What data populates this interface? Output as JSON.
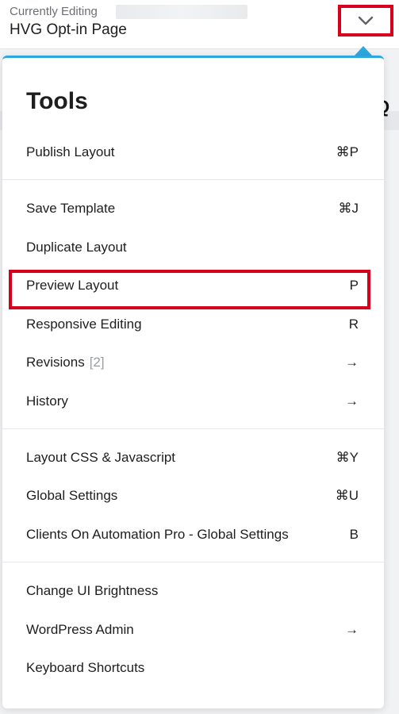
{
  "header": {
    "subtitle": "Currently Editing",
    "title": "HVG Opt-in Page",
    "toggle_icon": "chevron-down-icon"
  },
  "panel": {
    "title": "Tools",
    "groups": [
      {
        "items": [
          {
            "label": "Publish Layout",
            "shortcut": "⌘P"
          }
        ]
      },
      {
        "items": [
          {
            "label": "Save Template",
            "shortcut": "⌘J"
          },
          {
            "label": "Duplicate Layout",
            "shortcut": ""
          },
          {
            "label": "Preview Layout",
            "shortcut": "P"
          },
          {
            "label": "Responsive Editing",
            "shortcut": "R"
          },
          {
            "label": "Revisions",
            "count": "[2]",
            "shortcut": "→"
          },
          {
            "label": "History",
            "shortcut": "→"
          }
        ]
      },
      {
        "items": [
          {
            "label": "Layout CSS & Javascript",
            "shortcut": "⌘Y"
          },
          {
            "label": "Global Settings",
            "shortcut": "⌘U"
          },
          {
            "label": "Clients On Automation Pro - Global Settings",
            "shortcut": "B"
          }
        ]
      },
      {
        "items": [
          {
            "label": "Change UI Brightness",
            "shortcut": ""
          },
          {
            "label": "WordPress Admin",
            "shortcut": "→"
          },
          {
            "label": "Keyboard Shortcuts",
            "shortcut": ""
          }
        ]
      }
    ]
  },
  "colors": {
    "accent": "#2ea7df",
    "highlight": "#d6001c"
  }
}
